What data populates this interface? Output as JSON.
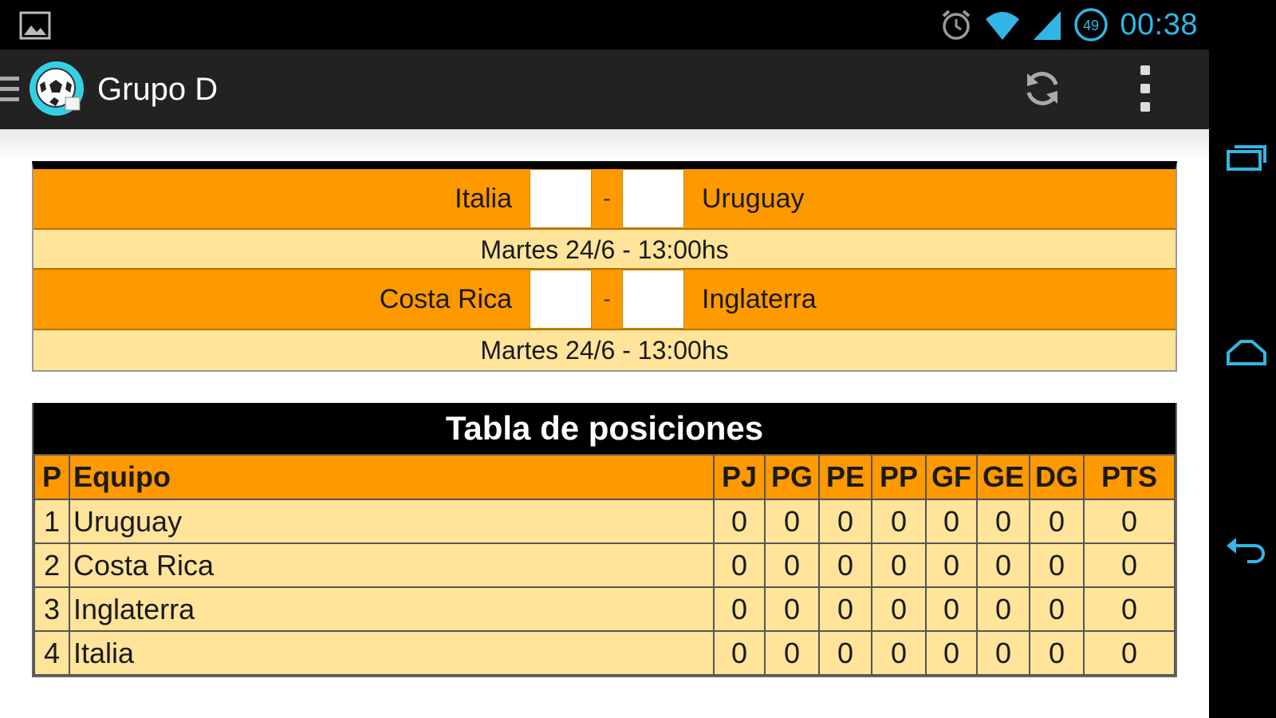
{
  "status_bar": {
    "time": "00:38",
    "battery_level": "49",
    "icons": [
      "gallery-icon",
      "alarm-icon",
      "wifi-icon",
      "signal-icon",
      "battery-icon"
    ]
  },
  "action_bar": {
    "title": "Grupo D",
    "icons": [
      "menu-icon",
      "app-logo-icon",
      "refresh-icon",
      "overflow-menu-icon"
    ]
  },
  "matches": [
    {
      "home": "Italia",
      "home_score": "",
      "separator": "-",
      "away_score": "",
      "away": "Uruguay",
      "date": "Martes 24/6 - 13:00hs"
    },
    {
      "home": "Costa Rica",
      "home_score": "",
      "separator": "-",
      "away_score": "",
      "away": "Inglaterra",
      "date": "Martes 24/6 - 13:00hs"
    }
  ],
  "standings": {
    "title": "Tabla de posiciones",
    "headers": [
      "P",
      "Equipo",
      "PJ",
      "PG",
      "PE",
      "PP",
      "GF",
      "GE",
      "DG",
      "PTS"
    ],
    "rows": [
      [
        "1",
        "Uruguay",
        "0",
        "0",
        "0",
        "0",
        "0",
        "0",
        "0",
        "0"
      ],
      [
        "2",
        "Costa Rica",
        "0",
        "0",
        "0",
        "0",
        "0",
        "0",
        "0",
        "0"
      ],
      [
        "3",
        "Inglaterra",
        "0",
        "0",
        "0",
        "0",
        "0",
        "0",
        "0",
        "0"
      ],
      [
        "4",
        "Italia",
        "0",
        "0",
        "0",
        "0",
        "0",
        "0",
        "0",
        "0"
      ]
    ]
  },
  "nav_bar": {
    "icons": [
      "recent-apps-icon",
      "home-icon",
      "back-icon"
    ]
  },
  "colors": {
    "accent": "#33b5e5",
    "match_row": "#ff9900",
    "light_row": "#ffe49a",
    "action_bar": "#222222"
  }
}
